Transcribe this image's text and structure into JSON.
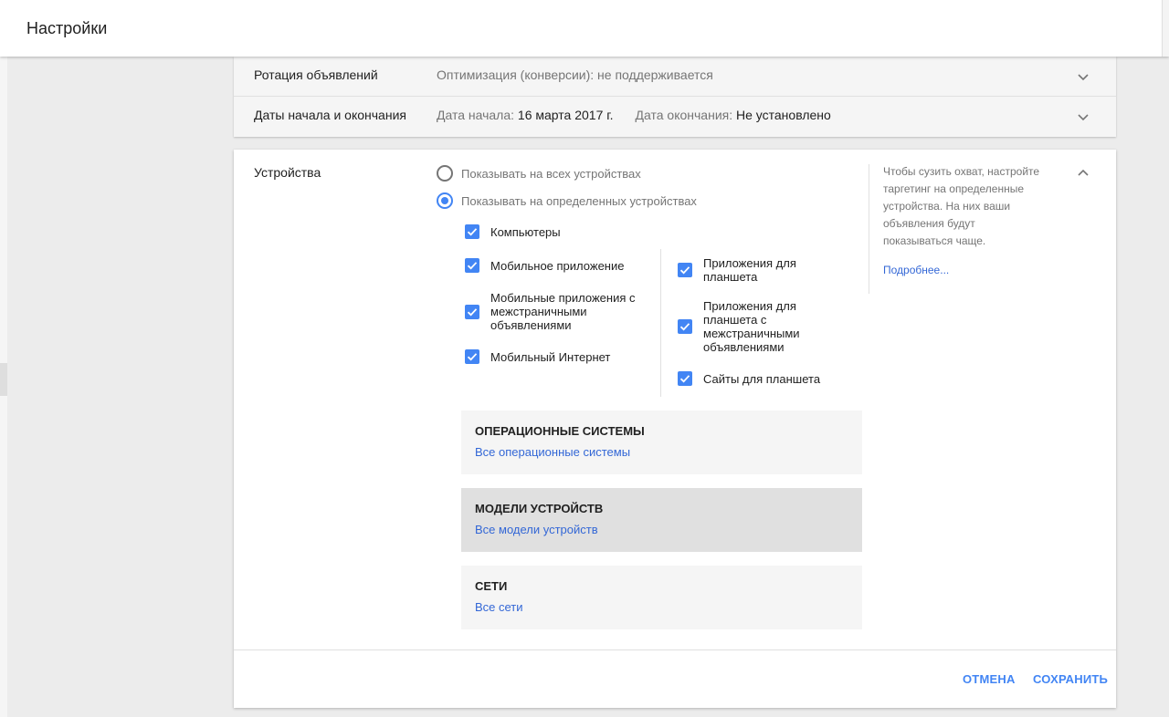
{
  "header": {
    "title": "Настройки"
  },
  "settings_rows": [
    {
      "label": "Ротация объявлений",
      "value": "Оптимизация (конверсии): не поддерживается"
    },
    {
      "label": "Даты начала и окончания",
      "start_label": "Дата начала:",
      "start_value": "16 марта 2017 г.",
      "end_label": "Дата окончания:",
      "end_value": "Не установлено"
    }
  ],
  "devices": {
    "label": "Устройства",
    "radio_all": "Показывать на всех устройствах",
    "radio_specific": "Показывать на определенных устройствах",
    "selected_option": "specific",
    "checkboxes": {
      "computers": "Компьютеры",
      "mobile_app": "Мобильное приложение",
      "mobile_apps_interstitial": "Мобильные приложения с межстраничными объявлениями",
      "mobile_web": "Мобильный Интернет",
      "tablet_apps": "Приложения для планшета",
      "tablet_apps_interstitial": "Приложения для планшета с межстраничными объявлениями",
      "tablet_sites": "Сайты для планшета"
    },
    "hint": "Чтобы сузить охват, настройте таргетинг на определенные устройства. На них ваши объявления будут показываться чаще.",
    "more_link": "Подробнее...",
    "panels": {
      "os": {
        "title": "ОПЕРАЦИОННЫЕ СИСТЕМЫ",
        "link": "Все операционные системы"
      },
      "models": {
        "title": "МОДЕЛИ УСТРОЙСТВ",
        "link": "Все модели устройств"
      },
      "networks": {
        "title": "СЕТИ",
        "link": "Все сети"
      }
    }
  },
  "footer": {
    "cancel": "ОТМЕНА",
    "save": "СОХРАНИТЬ"
  },
  "colors": {
    "accent": "#4285f4",
    "link": "#3367d6",
    "text": "#212121",
    "muted": "#757575"
  },
  "icons": {
    "collapsed_row": "chevron-down-icon",
    "expanded_section": "chevron-up-icon",
    "checkbox": "check-icon"
  }
}
